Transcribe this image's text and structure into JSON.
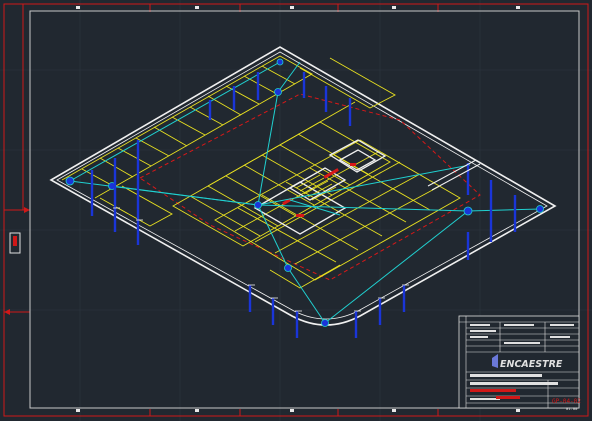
{
  "drawing": {
    "title_block": {
      "company_name": "ENCAESTRE",
      "sheet_number": "GP-04-02",
      "footer_code": "01.00"
    }
  },
  "colors": {
    "background": "#212830",
    "frame": "#c8c8c8",
    "border_red": "#d01818",
    "parking_lines": "#e8e020",
    "cable_routes": "#20d0d0",
    "columns": "#1a35d8",
    "outline": "#f0f0f0",
    "dashed_boundary": "#d81818"
  }
}
